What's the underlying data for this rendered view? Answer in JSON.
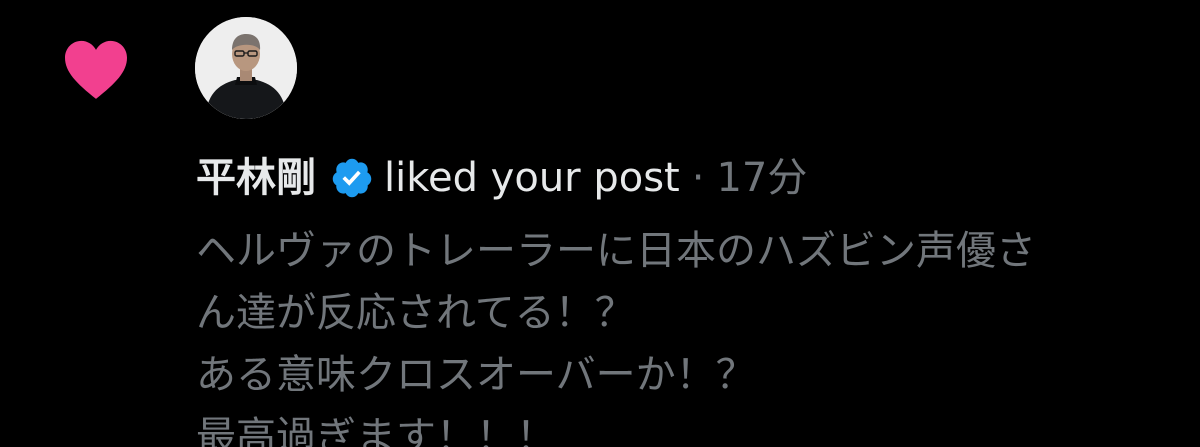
{
  "notification": {
    "type_icon": "heart-icon",
    "user": {
      "name": "平林剛",
      "verified": true,
      "avatar": "profile-photo"
    },
    "action": "liked your post",
    "separator": "·",
    "time": "17分",
    "post_lines": [
      "ヘルヴァのトレーラーに日本のハズビン声優さ",
      "ん達が反応されてる！？",
      "ある意味クロスオーバーか！？",
      "最高過ぎます！！！"
    ]
  },
  "colors": {
    "background": "#000000",
    "heart": "#f2408f",
    "verified_badge": "#1d9bf0",
    "primary_text": "#e7e9ea",
    "secondary_text": "#71767b"
  }
}
